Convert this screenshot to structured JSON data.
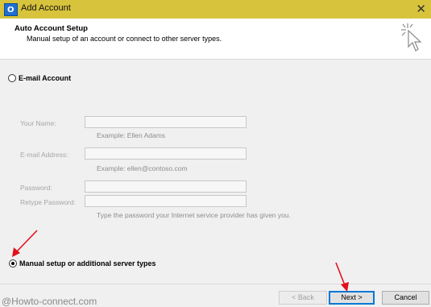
{
  "window": {
    "title": "Add Account",
    "close_glyph": "✕"
  },
  "header": {
    "title": "Auto Account Setup",
    "subtitle": "Manual setup of an account or connect to other server types."
  },
  "options": {
    "email_account": {
      "label": "E-mail Account",
      "selected": false
    },
    "manual_setup": {
      "label": "Manual setup or additional server types",
      "selected": true
    }
  },
  "fields": {
    "your_name": {
      "label": "Your Name:",
      "value": "",
      "hint": "Example: Ellen Adams"
    },
    "email_address": {
      "label": "E-mail Address:",
      "value": "",
      "hint": "Example: ellen@contoso.com"
    },
    "password": {
      "label": "Password:",
      "value": ""
    },
    "retype_password": {
      "label": "Retype Password:",
      "value": ""
    },
    "password_hint": "Type the password your Internet service provider has given you."
  },
  "buttons": {
    "back": "< Back",
    "next": "Next >",
    "cancel": "Cancel"
  },
  "watermark": "@Howto-connect.com",
  "colors": {
    "titlebar": "#d8c33c",
    "annotation_arrow": "#e3101a",
    "focus_border": "#0078d7"
  }
}
